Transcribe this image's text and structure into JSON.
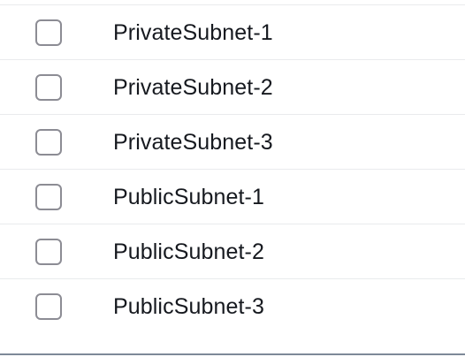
{
  "subnets": {
    "items": [
      {
        "label": "PrivateSubnet-1",
        "checked": false
      },
      {
        "label": "PrivateSubnet-2",
        "checked": false
      },
      {
        "label": "PrivateSubnet-3",
        "checked": false
      },
      {
        "label": "PublicSubnet-1",
        "checked": false
      },
      {
        "label": "PublicSubnet-2",
        "checked": false
      },
      {
        "label": "PublicSubnet-3",
        "checked": false
      }
    ]
  }
}
